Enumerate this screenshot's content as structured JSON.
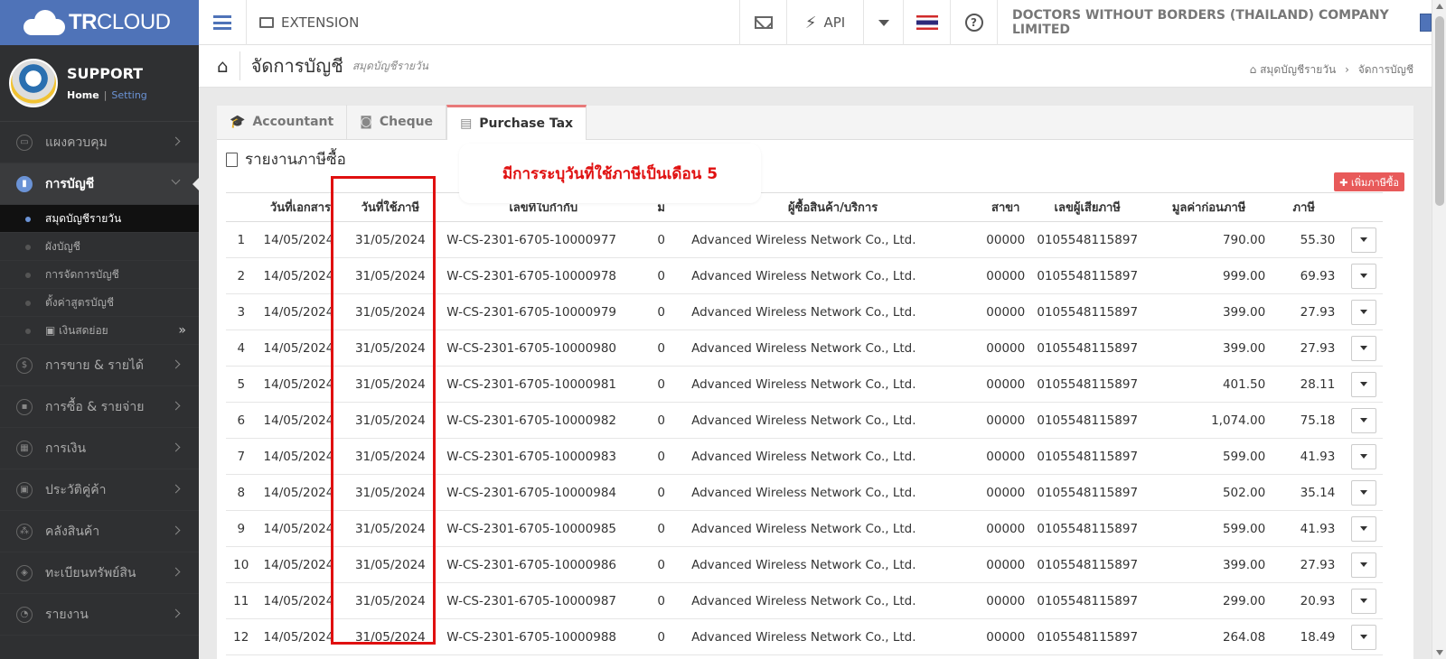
{
  "topbar": {
    "brand_bold": "TR",
    "brand_light": "CLOUD",
    "extension_label": "EXTENSION",
    "api_label": "API",
    "company": "DOCTORS WITHOUT BORDERS (THAILAND) COMPANY LIMITED"
  },
  "sidebar": {
    "user": {
      "name": "SUPPORT",
      "home": "Home",
      "sep": "|",
      "setting": "Setting"
    },
    "items": [
      {
        "label": "แผงควบคุม",
        "icon": "monitor-icon",
        "glyph": "▭"
      },
      {
        "label": "การบัญชี",
        "icon": "book-icon",
        "glyph": "▮"
      },
      {
        "label": "การขาย & รายได้",
        "icon": "dollar-icon",
        "glyph": "$"
      },
      {
        "label": "การซื้อ & รายจ่าย",
        "icon": "cart-icon",
        "glyph": "▪"
      },
      {
        "label": "การเงิน",
        "icon": "calendar-icon",
        "glyph": "▦"
      },
      {
        "label": "ประวัติคู่ค้า",
        "icon": "contact-icon",
        "glyph": "▣"
      },
      {
        "label": "คลังสินค้า",
        "icon": "cubes-icon",
        "glyph": "⁂"
      },
      {
        "label": "ทะเบียนทรัพย์สิน",
        "icon": "diamond-icon",
        "glyph": "◈"
      },
      {
        "label": "รายงาน",
        "icon": "report-icon",
        "glyph": "◔"
      }
    ],
    "subitems": [
      {
        "label": "สมุดบัญชีรายวัน"
      },
      {
        "label": "ผังบัญชี"
      },
      {
        "label": "การจัดการบัญชี"
      },
      {
        "label": "ตั้งค่าสูตรบัญชี"
      },
      {
        "label": "▣ เงินสดย่อย"
      }
    ]
  },
  "page": {
    "title": "จัดการบัญชี",
    "subtitle": "สมุดบัญชีรายวัน",
    "breadcrumb": [
      "สมุดบัญชีรายวัน",
      "›",
      "จัดการบัญชี"
    ]
  },
  "tabs": [
    {
      "label": "Accountant",
      "icon": "graduation-cap-icon",
      "glyph": "🎓"
    },
    {
      "label": "Cheque",
      "icon": "money-icon",
      "glyph": "◙"
    },
    {
      "label": "Purchase Tax",
      "icon": "document-icon",
      "glyph": "▤"
    }
  ],
  "report": {
    "title": "รายงานภาษีซื้อ",
    "callout": "มีการระบุวันที่ใช้ภาษีเป็นเดือน 5",
    "add_button": "✚ เพิ่มภาษีซื้อ"
  },
  "table": {
    "headers": [
      "",
      "วันที่เอกสาร",
      "วันที่ใช้ภาษี",
      "เลขที่ใบกำกับ",
      "ม",
      "ผู้ซื้อสินค้า/บริการ",
      "สาขา",
      "เลขผู้เสียภาษี",
      "มูลค่าก่อนภาษี",
      "ภาษี",
      ""
    ],
    "rows": [
      [
        "1",
        "14/05/2024",
        "31/05/2024",
        "W-CS-2301-6705-10000977",
        "0",
        "Advanced Wireless Network Co., Ltd.",
        "00000",
        "0105548115897",
        "790.00",
        "55.30"
      ],
      [
        "2",
        "14/05/2024",
        "31/05/2024",
        "W-CS-2301-6705-10000978",
        "0",
        "Advanced Wireless Network Co., Ltd.",
        "00000",
        "0105548115897",
        "999.00",
        "69.93"
      ],
      [
        "3",
        "14/05/2024",
        "31/05/2024",
        "W-CS-2301-6705-10000979",
        "0",
        "Advanced Wireless Network Co., Ltd.",
        "00000",
        "0105548115897",
        "399.00",
        "27.93"
      ],
      [
        "4",
        "14/05/2024",
        "31/05/2024",
        "W-CS-2301-6705-10000980",
        "0",
        "Advanced Wireless Network Co., Ltd.",
        "00000",
        "0105548115897",
        "399.00",
        "27.93"
      ],
      [
        "5",
        "14/05/2024",
        "31/05/2024",
        "W-CS-2301-6705-10000981",
        "0",
        "Advanced Wireless Network Co., Ltd.",
        "00000",
        "0105548115897",
        "401.50",
        "28.11"
      ],
      [
        "6",
        "14/05/2024",
        "31/05/2024",
        "W-CS-2301-6705-10000982",
        "0",
        "Advanced Wireless Network Co., Ltd.",
        "00000",
        "0105548115897",
        "1,074.00",
        "75.18"
      ],
      [
        "7",
        "14/05/2024",
        "31/05/2024",
        "W-CS-2301-6705-10000983",
        "0",
        "Advanced Wireless Network Co., Ltd.",
        "00000",
        "0105548115897",
        "599.00",
        "41.93"
      ],
      [
        "8",
        "14/05/2024",
        "31/05/2024",
        "W-CS-2301-6705-10000984",
        "0",
        "Advanced Wireless Network Co., Ltd.",
        "00000",
        "0105548115897",
        "502.00",
        "35.14"
      ],
      [
        "9",
        "14/05/2024",
        "31/05/2024",
        "W-CS-2301-6705-10000985",
        "0",
        "Advanced Wireless Network Co., Ltd.",
        "00000",
        "0105548115897",
        "599.00",
        "41.93"
      ],
      [
        "10",
        "14/05/2024",
        "31/05/2024",
        "W-CS-2301-6705-10000986",
        "0",
        "Advanced Wireless Network Co., Ltd.",
        "00000",
        "0105548115897",
        "399.00",
        "27.93"
      ],
      [
        "11",
        "14/05/2024",
        "31/05/2024",
        "W-CS-2301-6705-10000987",
        "0",
        "Advanced Wireless Network Co., Ltd.",
        "00000",
        "0105548115897",
        "299.00",
        "20.93"
      ],
      [
        "12",
        "14/05/2024",
        "31/05/2024",
        "W-CS-2301-6705-10000988",
        "0",
        "Advanced Wireless Network Co., Ltd.",
        "00000",
        "0105548115897",
        "264.08",
        "18.49"
      ]
    ]
  },
  "colors": {
    "brand": "#4f73b8",
    "sidebar": "#2f3032",
    "highlight": "#e01010",
    "add_button": "#e85a5a",
    "active_tab": "#e87979"
  }
}
